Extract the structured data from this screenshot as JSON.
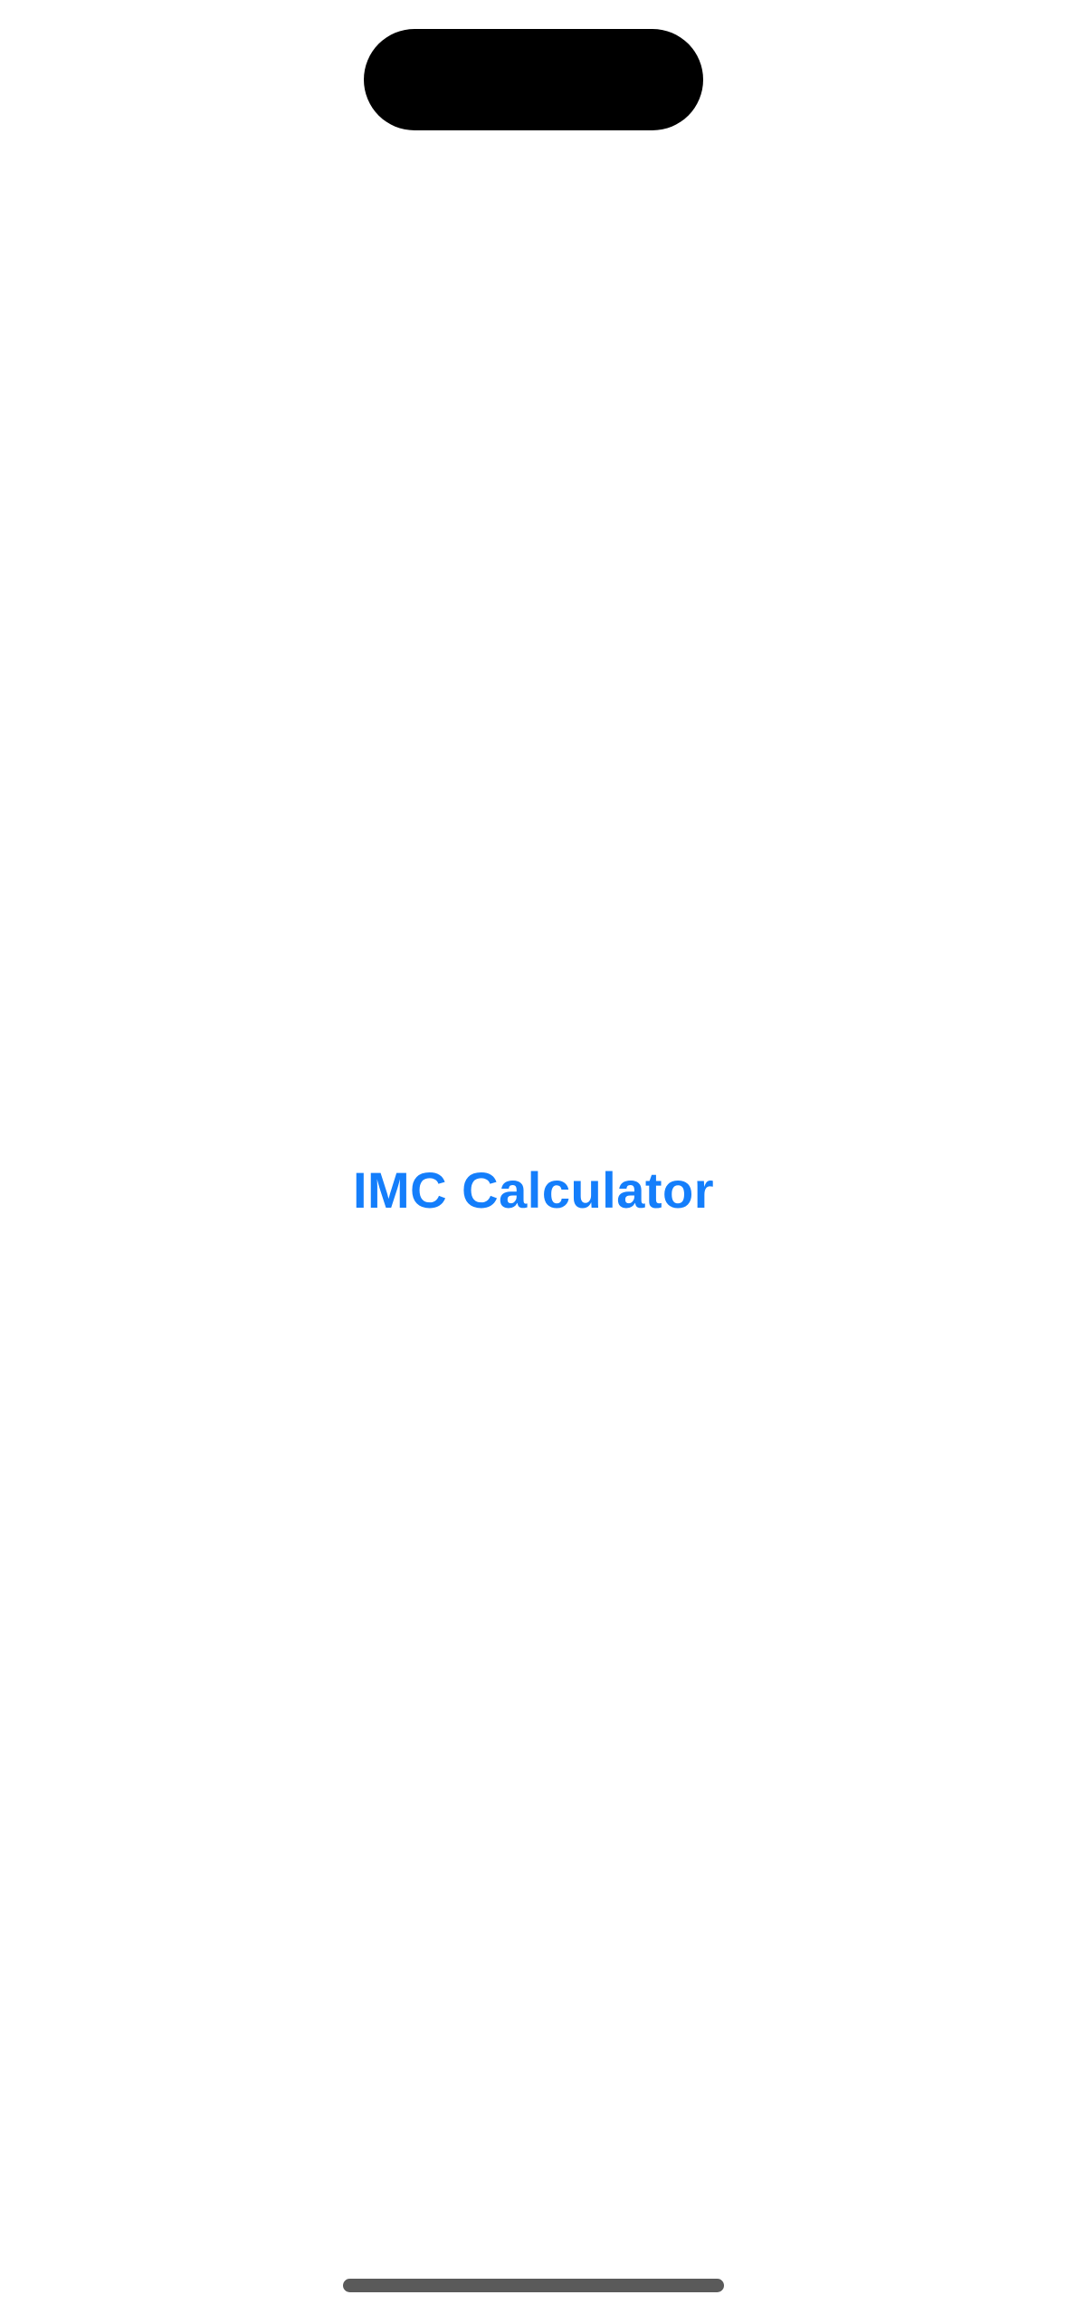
{
  "app": {
    "title": "IMC Calculator"
  },
  "colors": {
    "accent": "#147EFB",
    "background": "#FFFFFF",
    "island": "#000000",
    "home_indicator": "#5A5A5A"
  }
}
